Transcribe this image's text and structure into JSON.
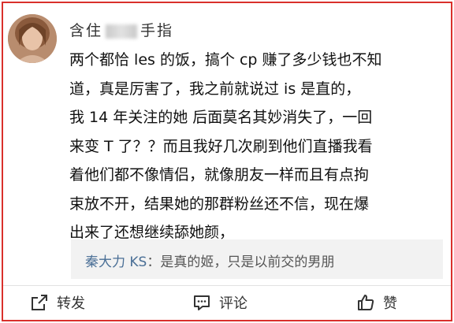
{
  "post": {
    "username_visible": "含住",
    "username_tail": "手指",
    "lines": [
      "两个都恰 les 的饭，搞个 cp 赚了多少钱也不知",
      "道，真是厉害了，我之前就说过 is 是直的，",
      "我 14 年关注的她 后面莫名其妙消失了，一回",
      "来变 T 了？？而且我好几次刷到他们直播我看",
      "着他们都不像情侣，就像朋友一样而且有点拘",
      "束放不开，结果她的那群粉丝还不信，现在爆",
      "出来了还想继续舔她颜，"
    ]
  },
  "reply": {
    "author": "秦大力 KS",
    "separator": "：",
    "text": "是真的姬，只是以前交的男朋"
  },
  "actions": {
    "forward": "转发",
    "comment": "评论",
    "like": "赞"
  },
  "colors": {
    "frame_border": "#d9302c",
    "reply_author": "#4a6f96",
    "reply_background": "#f2f2f2"
  },
  "icons": [
    "avatar",
    "share-icon",
    "comment-icon",
    "thumbs-up-icon"
  ]
}
